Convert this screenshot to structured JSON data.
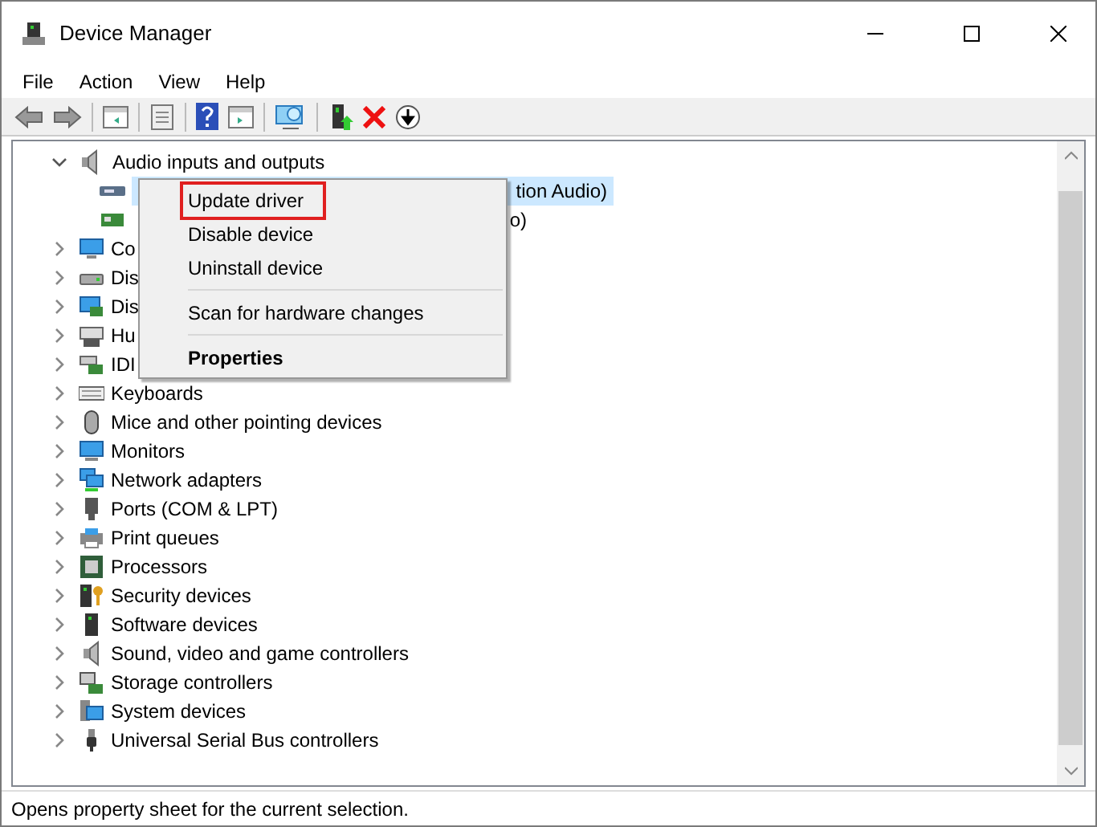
{
  "window": {
    "title": "Device Manager"
  },
  "menu_bar": [
    "File",
    "Action",
    "View",
    "Help"
  ],
  "tree": {
    "label": "Audio inputs and outputs",
    "expanded": true,
    "children": [
      {
        "label": "tion Audio)",
        "selected": true
      },
      {
        "label": "o)",
        "selected": false
      }
    ]
  },
  "categories": [
    {
      "label": "Co",
      "expanded": false
    },
    {
      "label": "Dis",
      "expanded": false
    },
    {
      "label": "Dis",
      "expanded": false
    },
    {
      "label": "Hu",
      "expanded": false
    },
    {
      "label": "IDI",
      "expanded": false
    },
    {
      "label": "Keyboards",
      "expanded": false
    },
    {
      "label": "Mice and other pointing devices",
      "expanded": false
    },
    {
      "label": "Monitors",
      "expanded": false
    },
    {
      "label": "Network adapters",
      "expanded": false
    },
    {
      "label": "Ports (COM & LPT)",
      "expanded": false
    },
    {
      "label": "Print queues",
      "expanded": false
    },
    {
      "label": "Processors",
      "expanded": false
    },
    {
      "label": "Security devices",
      "expanded": false
    },
    {
      "label": "Software devices",
      "expanded": false
    },
    {
      "label": "Sound, video and game controllers",
      "expanded": false
    },
    {
      "label": "Storage controllers",
      "expanded": false
    },
    {
      "label": "System devices",
      "expanded": false
    },
    {
      "label": "Universal Serial Bus controllers",
      "expanded": false
    }
  ],
  "context_menu": [
    {
      "kind": "item",
      "label": "Update driver",
      "outlined": true,
      "bold": false
    },
    {
      "kind": "item",
      "label": "Disable device",
      "outlined": false,
      "bold": false
    },
    {
      "kind": "item",
      "label": "Uninstall device",
      "outlined": false,
      "bold": false
    },
    {
      "kind": "separator"
    },
    {
      "kind": "item",
      "label": "Scan for hardware changes",
      "outlined": false,
      "bold": false
    },
    {
      "kind": "separator"
    },
    {
      "kind": "item",
      "label": "Properties",
      "outlined": false,
      "bold": true
    }
  ],
  "status_bar": "Opens property sheet for the current selection."
}
